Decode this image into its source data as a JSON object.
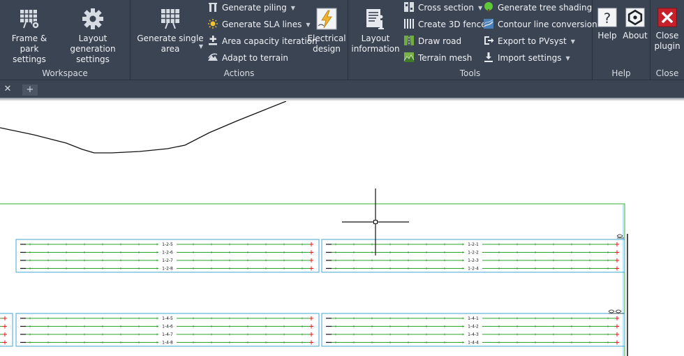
{
  "ribbon": {
    "panels": {
      "workspace": "Workspace",
      "actions": "Actions",
      "tools": "Tools",
      "help": "Help",
      "close": "Close"
    },
    "workspace": {
      "frame_park": "Frame & park\nsettings",
      "layout_generation": "Layout generation\nsettings"
    },
    "actions": {
      "generate_single": "Generate single\narea",
      "generate_piling": "Generate piling",
      "generate_sla": "Generate SLA lines",
      "area_capacity": "Area capacity iteration",
      "adapt_terrain": "Adapt to terrain",
      "electrical_design": "Electrical\ndesign"
    },
    "tools": {
      "layout_information": "Layout\ninformation",
      "cross_section": "Cross section",
      "create_3d_fence": "Create 3D fence",
      "draw_road": "Draw road",
      "terrain_mesh": "Terrain mesh",
      "generate_tree_shading": "Generate tree shading",
      "contour_line_conversion": "Contour line conversion",
      "export_pvsyst": "Export to PVsyst",
      "import_settings": "Import settings"
    },
    "help": {
      "help": "Help",
      "about": "About"
    },
    "close": {
      "close_plugin": "Close\nplugin"
    },
    "colors": {
      "ribbon_bg": "#3b4453",
      "tree_shading_dot": "#5cc83a",
      "close_red": "#c8202a"
    }
  },
  "tabs": {
    "close_symbol": "✕",
    "new_symbol": "+"
  },
  "drawing": {
    "upper_left_labels": [
      "1-2-5",
      "1-2-6",
      "1-2-7",
      "1-2-8"
    ],
    "upper_right_labels": [
      "1-2-1",
      "1-2-2",
      "1-2-3",
      "1-2-4"
    ],
    "lower_left_labels": [
      "1-4-5",
      "1-4-6",
      "1-4-7",
      "1-4-8"
    ],
    "lower_right_labels": [
      "1-4-1",
      "1-4-2",
      "1-4-3",
      "1-4-4"
    ],
    "colors": {
      "row_line": "#2aa52a",
      "block_border": "#3fa7d6",
      "boundary": "#33b233",
      "end_mark": "#e01818"
    }
  }
}
